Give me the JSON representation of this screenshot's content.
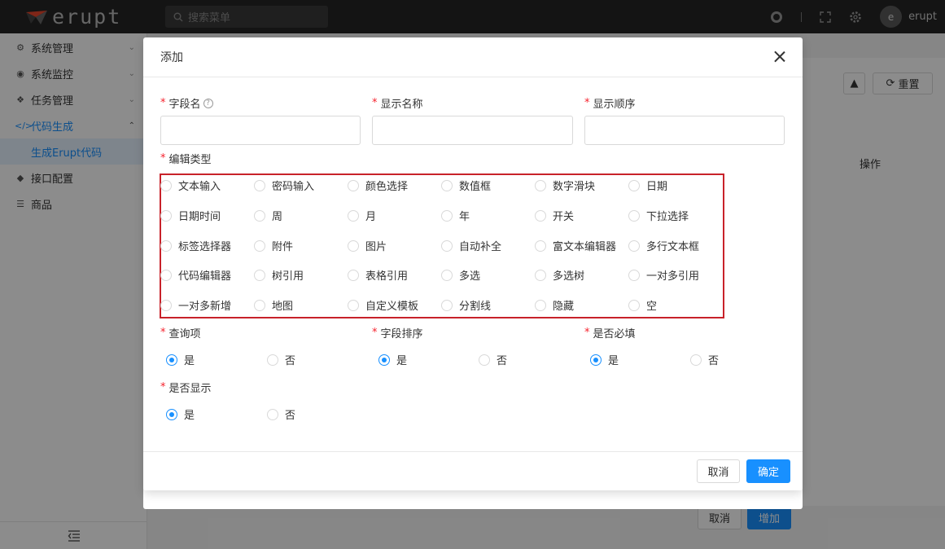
{
  "app": {
    "brand": "erupt",
    "search_placeholder": "搜索菜单",
    "avatar_letter": "e",
    "username": "erupt"
  },
  "sidebar": {
    "items": [
      {
        "label": "系统管理",
        "icon": "gears-icon"
      },
      {
        "label": "系统监控",
        "icon": "monitor-icon"
      },
      {
        "label": "任务管理",
        "icon": "tasks-icon"
      },
      {
        "label": "代码生成",
        "icon": "code-icon"
      },
      {
        "label": "生成Erupt代码",
        "icon": ""
      },
      {
        "label": "接口配置",
        "icon": "cube-icon"
      },
      {
        "label": "商品",
        "icon": "list-icon"
      }
    ]
  },
  "background": {
    "reset_label": "重置",
    "operation_header": "操作",
    "cancel_label": "取消",
    "add_label": "增加"
  },
  "modal": {
    "title": "添加",
    "fields": {
      "field_name": "字段名",
      "display_name": "显示名称",
      "display_order": "显示顺序",
      "edit_type": "编辑类型",
      "query_item": "查询项",
      "field_sort": "字段排序",
      "required": "是否必填",
      "show": "是否显示"
    },
    "edit_types": [
      [
        "文本输入",
        "密码输入",
        "颜色选择",
        "数值框",
        "数字滑块",
        "日期"
      ],
      [
        "日期时间",
        "周",
        "月",
        "年",
        "开关",
        "下拉选择"
      ],
      [
        "标签选择器",
        "附件",
        "图片",
        "自动补全",
        "富文本编辑器",
        "多行文本框"
      ],
      [
        "代码编辑器",
        "树引用",
        "表格引用",
        "多选",
        "多选树",
        "一对多引用"
      ],
      [
        "一对多新增",
        "地图",
        "自定义模板",
        "分割线",
        "隐藏",
        "空"
      ]
    ],
    "yes": "是",
    "no": "否",
    "cancel_label": "取消",
    "confirm_label": "确定"
  },
  "colors": {
    "primary": "#1890ff",
    "required": "#f5222d",
    "highlight_border": "#c8222a",
    "topbar": "#262626"
  }
}
